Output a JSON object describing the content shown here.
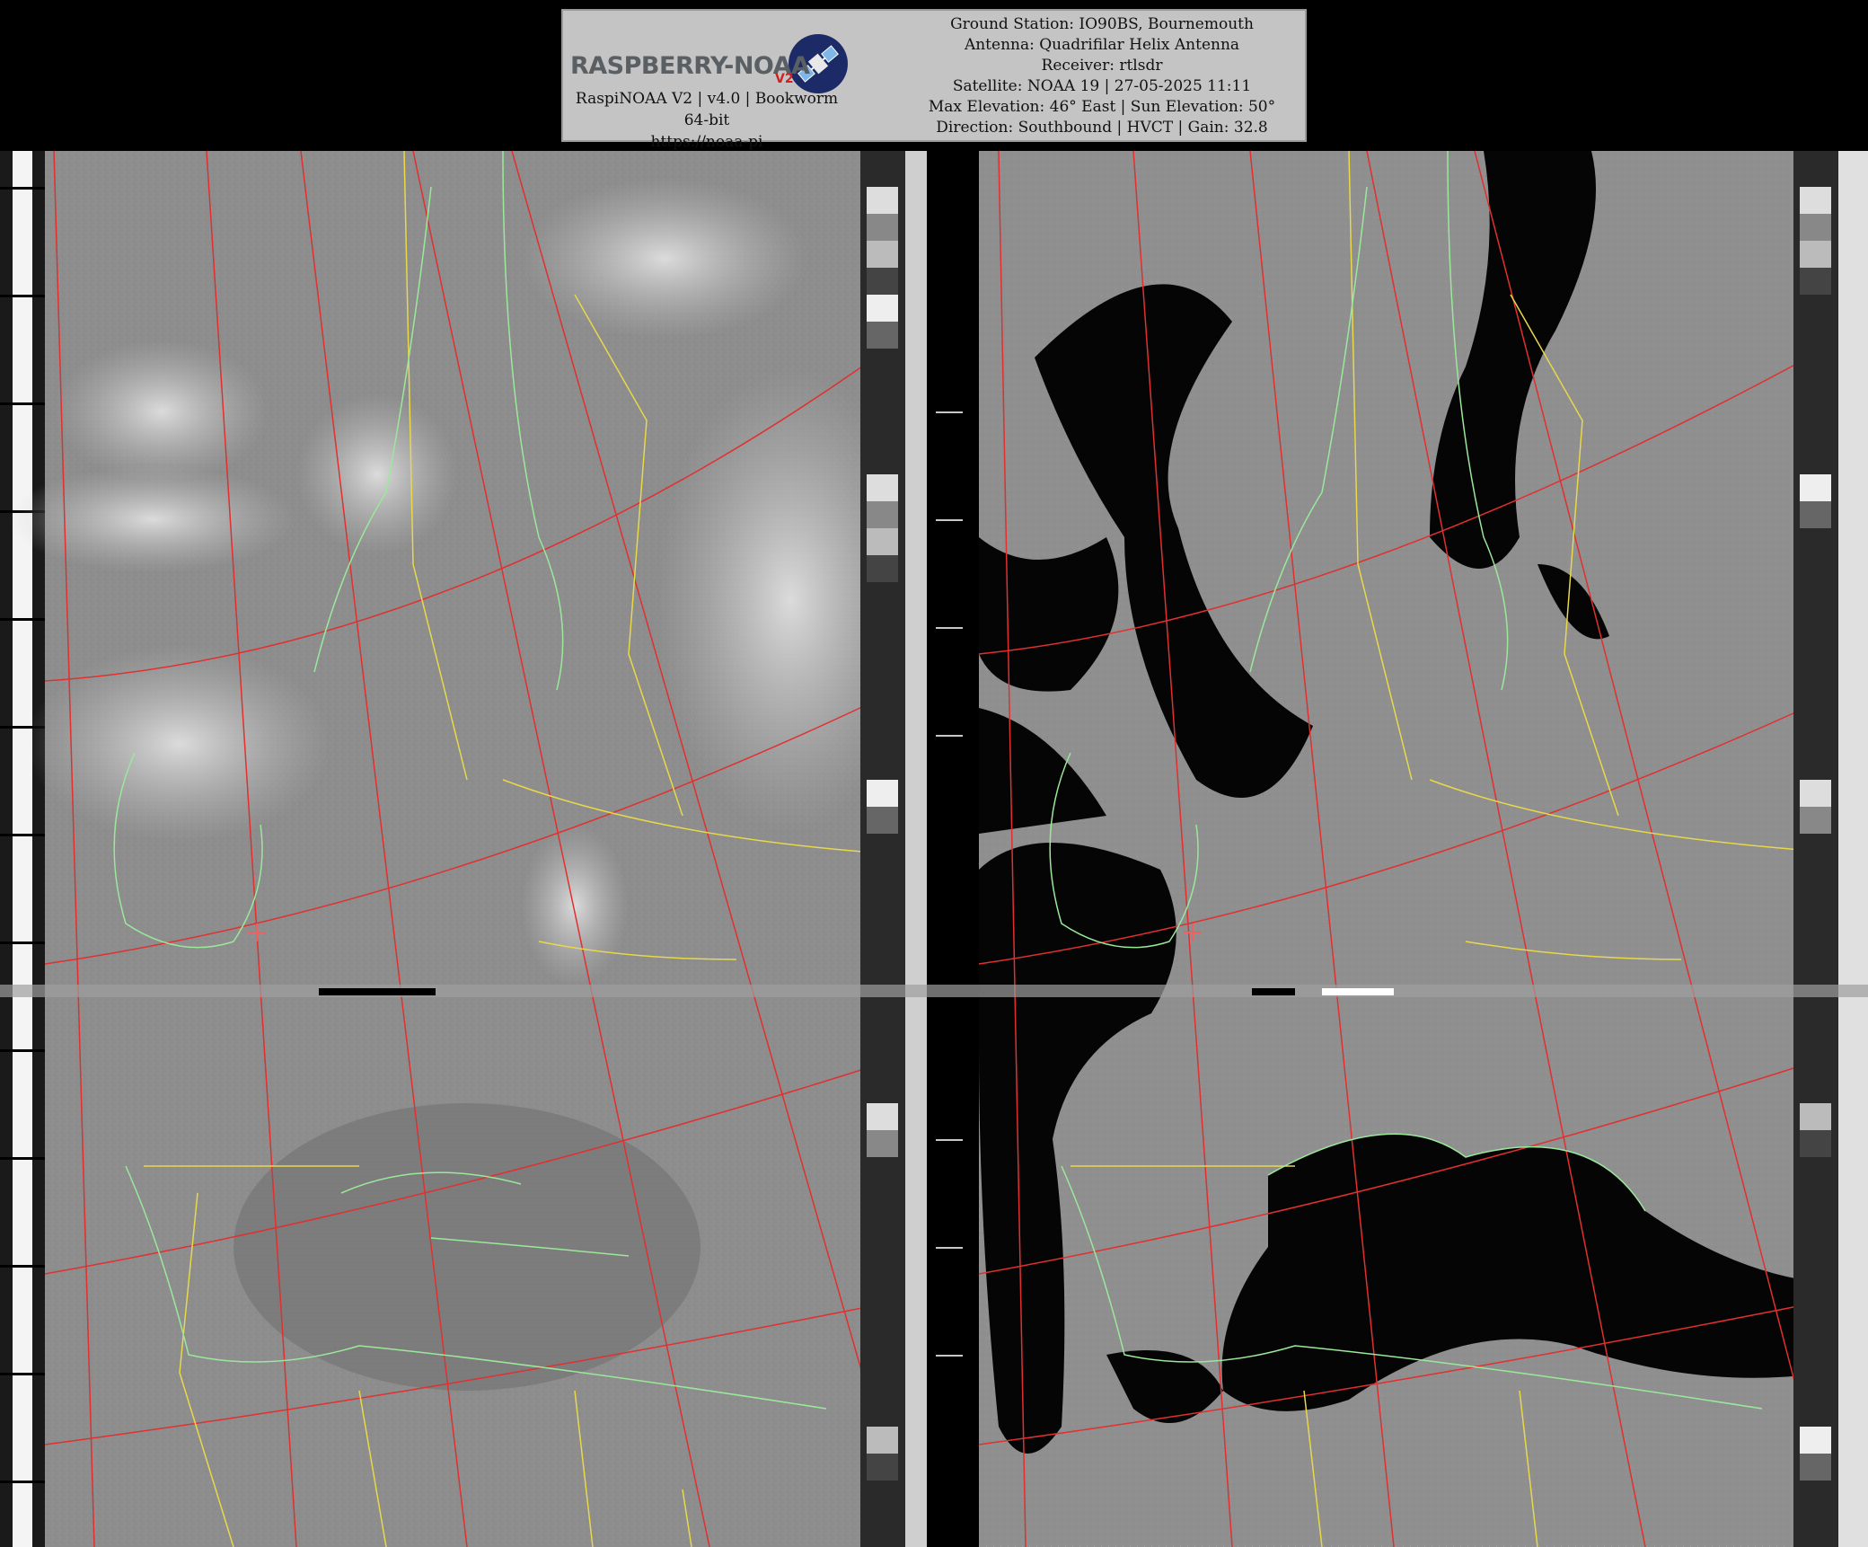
{
  "header": {
    "logo_text": "RASPBERRY-NOAA",
    "logo_version": "V2",
    "software_line": "RaspiNOAA V2 | v4.0 | Bookworm 64-bit",
    "url_line": "https://noaa-pi",
    "ground_station": "Ground Station: IO90BS, Bournemouth",
    "antenna": "Antenna: Quadrifilar Helix Antenna",
    "receiver": "Receiver: rtlsdr",
    "satellite": "Satellite: NOAA 19 | 27-05-2025 11:11",
    "elevation": "Max Elevation: 46° East | Sun Elevation: 50°",
    "direction": "Direction: Southbound | HVCT | Gain: 32.8"
  },
  "colors": {
    "header_bg": "#c4c4c4",
    "coastline": "#9be89b",
    "borders": "#e8d84a",
    "graticule": "#e03030",
    "logo_red": "#d42020",
    "logo_navy": "#1d2a68"
  },
  "icons": {
    "logo": "satellite-logo-icon",
    "station_marker": "plus-marker-icon"
  }
}
